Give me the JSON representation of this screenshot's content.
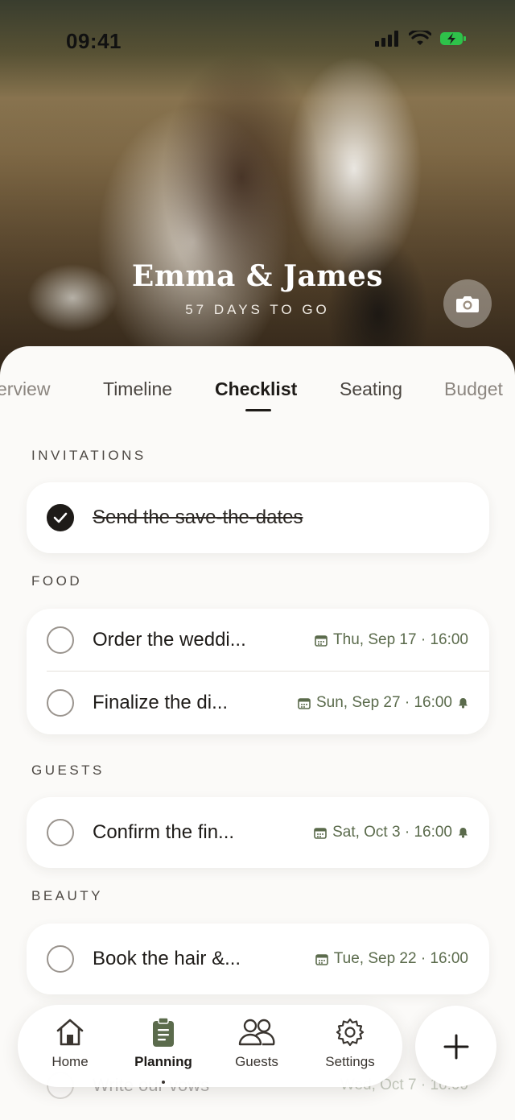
{
  "status_bar": {
    "time": "09:41"
  },
  "hero": {
    "couple": "Emma & James",
    "countdown": "57 DAYS TO GO"
  },
  "tabs": [
    {
      "label": "Overview",
      "visible_label": "erview"
    },
    {
      "label": "Timeline"
    },
    {
      "label": "Checklist",
      "active": true
    },
    {
      "label": "Seating"
    },
    {
      "label": "Budget"
    }
  ],
  "sections": [
    {
      "title": "INVITATIONS",
      "tasks": [
        {
          "text": "Send the save-the-dates",
          "done": true
        }
      ]
    },
    {
      "title": "FOOD",
      "tasks": [
        {
          "text": "Order the weddi...",
          "done": false,
          "due": "Thu, Sep 17 · 16:00",
          "reminder": false
        },
        {
          "text": "Finalize the di...",
          "done": false,
          "due": "Sun, Sep 27 · 16:00",
          "reminder": true
        }
      ]
    },
    {
      "title": "GUESTS",
      "tasks": [
        {
          "text": "Confirm the fin...",
          "done": false,
          "due": "Sat, Oct 3 · 16:00",
          "reminder": true
        }
      ]
    },
    {
      "title": "BEAUTY",
      "tasks": [
        {
          "text": "Book the hair &...",
          "done": false,
          "due": "Tue, Sep 22 · 16:00",
          "reminder": false
        }
      ]
    }
  ],
  "obscured_task": {
    "text": "Write our vows",
    "due": "Wed, Oct 7 · 16:00"
  },
  "nav": [
    {
      "label": "Home",
      "icon": "home-icon"
    },
    {
      "label": "Planning",
      "icon": "clipboard-icon",
      "active": true
    },
    {
      "label": "Guests",
      "icon": "people-icon"
    },
    {
      "label": "Settings",
      "icon": "gear-icon"
    }
  ],
  "fab": {
    "icon": "plus-icon"
  },
  "colors": {
    "accent": "#5b6b4c",
    "text": "#1e1b18",
    "background": "#fbfaf8"
  }
}
